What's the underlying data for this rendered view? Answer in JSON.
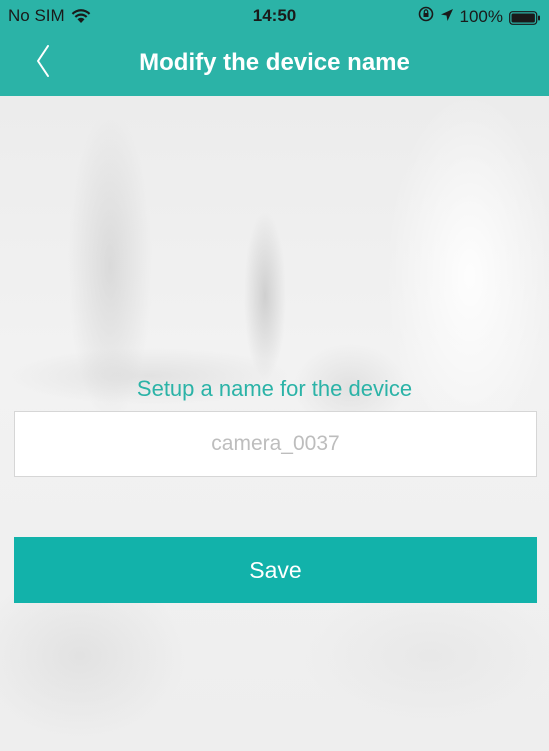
{
  "status_bar": {
    "carrier": "No SIM",
    "time": "14:50",
    "battery_percent": "100%",
    "icons": [
      "wifi-icon",
      "orientation-lock-icon",
      "location-icon",
      "battery-icon"
    ]
  },
  "nav": {
    "title": "Modify the device name",
    "back_icon": "chevron-left-icon"
  },
  "form": {
    "label": "Setup a name for the device",
    "name_input": {
      "value": "",
      "placeholder": "camera_0037"
    },
    "save_label": "Save"
  },
  "colors": {
    "header_bg": "#2bb3a7",
    "accent_text": "#2bb3a7",
    "button_bg": "#12b2aa",
    "page_bg": "#f3f3f3"
  }
}
